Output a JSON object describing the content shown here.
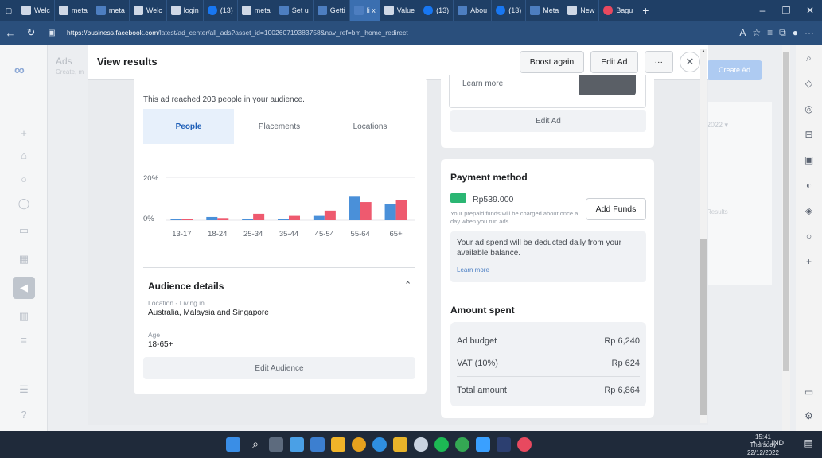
{
  "browser": {
    "tabs": [
      {
        "label": "Welc"
      },
      {
        "label": "meta"
      },
      {
        "label": "meta"
      },
      {
        "label": "Welc"
      },
      {
        "label": "login"
      },
      {
        "label": "(13)"
      },
      {
        "label": "meta"
      },
      {
        "label": "Set u"
      },
      {
        "label": "Getti"
      },
      {
        "label": "li x"
      },
      {
        "label": "Value"
      },
      {
        "label": "(13)"
      },
      {
        "label": "Abou"
      },
      {
        "label": "(13)"
      },
      {
        "label": "Meta"
      },
      {
        "label": "New"
      },
      {
        "label": "Bagu"
      }
    ],
    "url_host": "https://business.facebook.com",
    "url_path": "/latest/ad_center/all_ads?asset_id=100260719383758&nav_ref=bm_home_redirect"
  },
  "background": {
    "title": "Ads",
    "subtitle": "Create, m",
    "create_button": "Create Ad",
    "date_hint": "2022 ▾",
    "results_hint": "Results"
  },
  "modal": {
    "title": "View results",
    "boost_again": "Boost again",
    "edit_ad": "Edit Ad",
    "more": "···",
    "close": "✕"
  },
  "reach": {
    "text": "This ad reached 203 people in your audience.",
    "tabs": [
      "People",
      "Placements",
      "Locations"
    ]
  },
  "chart_data": {
    "type": "bar",
    "categories": [
      "13-17",
      "18-24",
      "25-34",
      "35-44",
      "45-54",
      "55-64",
      "65+"
    ],
    "series": [
      {
        "values": [
          0.5,
          1.5,
          0.5,
          0.5,
          2,
          11,
          7.5
        ],
        "color": "#4a90d9"
      },
      {
        "values": [
          0.5,
          1,
          3,
          2,
          4.5,
          8.5,
          9.5
        ],
        "color": "#ee5a6f"
      }
    ],
    "yticks": [
      "20%",
      "0%"
    ],
    "ylim": [
      0,
      22
    ]
  },
  "audience": {
    "title": "Audience details",
    "location_label": "Location - Living in",
    "location_value": "Australia, Malaysia and Singapore",
    "age_label": "Age",
    "age_value": "18-65+",
    "edit_button": "Edit Audience"
  },
  "preview": {
    "learn_more": "Learn more",
    "edit_ad": "Edit Ad"
  },
  "payment": {
    "title": "Payment method",
    "amount": "Rp539.000",
    "note": "Your prepaid funds will be charged about once a day when you run ads.",
    "add_funds": "Add Funds",
    "info_text": "Your ad spend will be deducted daily from your available balance.",
    "learn_more": "Learn more"
  },
  "amount_spent": {
    "title": "Amount spent",
    "rows": [
      {
        "label": "Ad budget",
        "value": "Rp 6,240"
      },
      {
        "label": "VAT (10%)",
        "value": "Rp 624"
      },
      {
        "label": "Total amount",
        "value": "Rp 6,864"
      }
    ]
  },
  "taskbar": {
    "language": "IND",
    "time": "15:41",
    "day": "Thursday",
    "date": "22/12/2022"
  },
  "colors": {
    "accent": "#1877f2",
    "male_bar": "#4a90d9",
    "female_bar": "#ee5a6f"
  }
}
